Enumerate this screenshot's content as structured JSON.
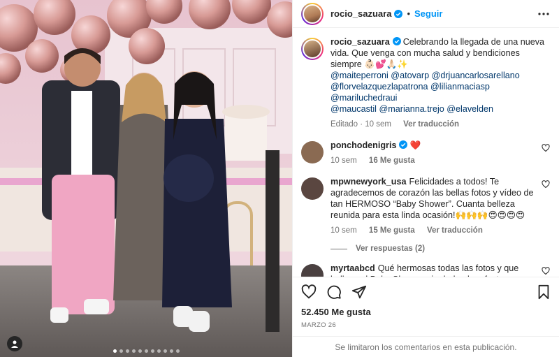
{
  "post": {
    "photo_alt": "Foto",
    "carousel": {
      "count": 11,
      "active": 0
    }
  },
  "header": {
    "username": "rocio_sazuara",
    "separator": "•",
    "follow_label": "Seguir"
  },
  "caption": {
    "username": "rocio_sazuara",
    "text": "Celebrando la llegada de una nueva vida. Que venga con mucha salud y bendiciones siempre 👶🏻💕🙏🏻✨",
    "mentions_line1": "@maiteperroni @atovarp @drjuancarlosarellano",
    "mentions_line2": "@florvelazquezlapatrona @lilianmaciasp @mariluchedraui",
    "mentions_line3": "@maucastil @marianna.trejo @elavelden",
    "meta_time": "Editado · 10 sem",
    "meta_action": "Ver traducción"
  },
  "comments": [
    {
      "username": "ponchodenigris",
      "text": "❤️",
      "time": "10 sem",
      "likes": "16 Me gusta",
      "translate": "",
      "avatar_color": "#8a6a52"
    },
    {
      "username": "mpwnewyork_usa",
      "text": "Felicidades a todos! Te agradecemos de corazón las bellas fotos y vídeo de tan HERMOSO “Baby Shower”. Cuanta belleza reunida para esta linda ocasión!🙌🙌🙌😍😍😍😍",
      "time": "10 sem",
      "likes": "15 Me gusta",
      "translate": "Ver traducción",
      "avatar_color": "#5a4640",
      "replies": "Ver respuestas (2)"
    },
    {
      "username": "myrtaabcd",
      "text": "Qué hermosas todas las fotos y que belleza el Baby Shower, sin duda el perfecto ejemplo de que, todo lo que se hace con amor está bien hecho. Hiciste un trabajo espectacular! Felicidades y muchas gracias 🫶❤️😍🥹👏👏👏",
      "time": "",
      "likes": "",
      "translate": "",
      "avatar_color": "#4a4040"
    }
  ],
  "actions": {
    "likes": "52.450 Me gusta",
    "date": "MARZO 26"
  },
  "footer": {
    "text": "Se limitaron los comentarios en esta publicación."
  },
  "icons": [
    "heart-icon",
    "comment-icon",
    "share-icon",
    "save-icon",
    "more-icon",
    "verified-icon",
    "user-tag-icon"
  ],
  "colors": {
    "link": "#0095f6",
    "mention": "#00376b",
    "meta": "#737373",
    "heart": "#ed4956"
  }
}
